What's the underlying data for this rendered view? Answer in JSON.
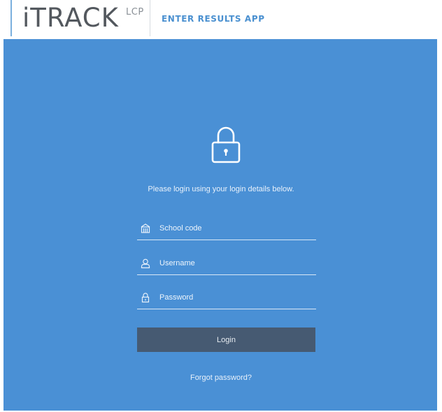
{
  "header": {
    "brand": "iTRACK",
    "brand_sup": "LCP",
    "app_name": "ENTER RESULTS APP"
  },
  "login": {
    "prompt": "Please login using your login details below.",
    "fields": [
      {
        "name": "school-code",
        "placeholder": "School code",
        "icon": "school-icon",
        "value": ""
      },
      {
        "name": "username",
        "placeholder": "Username",
        "icon": "user-icon",
        "value": ""
      },
      {
        "name": "password",
        "placeholder": "Password",
        "icon": "lock-small-icon",
        "value": ""
      }
    ],
    "button_label": "Login",
    "forgot_label": "Forgot password?",
    "lock_icon": "lock-icon"
  },
  "colors": {
    "panel": "#4a90d5",
    "button": "#465a72",
    "brand_text": "#53585e",
    "app_name": "#4a90d0"
  }
}
